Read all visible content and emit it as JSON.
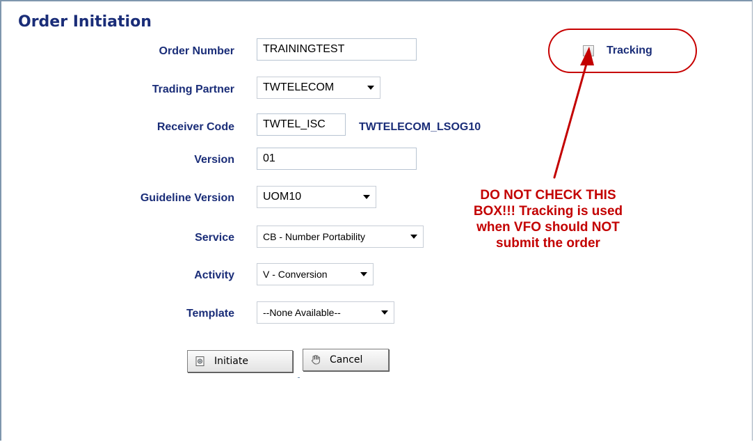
{
  "page": {
    "title": "Order Initiation"
  },
  "fields": {
    "order_number": {
      "label": "Order Number",
      "value": "TRAININGTEST"
    },
    "trading_partner": {
      "label": "Trading Partner",
      "value": "TWTELECOM"
    },
    "receiver_code": {
      "label": "Receiver Code",
      "value": "TWTEL_ISC",
      "name": "TWTELECOM_LSOG10"
    },
    "version": {
      "label": "Version",
      "value": "01"
    },
    "guideline_version": {
      "label": "Guideline Version",
      "value": "UOM10"
    },
    "service": {
      "label": "Service",
      "value": "CB - Number Portability"
    },
    "activity": {
      "label": "Activity",
      "value": "V - Conversion"
    },
    "template": {
      "label": "Template",
      "value": "--None Available--"
    }
  },
  "tracking": {
    "label": "Tracking",
    "checked": false
  },
  "annotation": {
    "text": "DO NOT CHECK THIS\nBOX!!!  Tracking is used\nwhen VFO should NOT\nsubmit the order",
    "color": "#c30000"
  },
  "buttons": {
    "initiate": {
      "label": "Initiate",
      "icon": "initiate-icon"
    },
    "cancel": {
      "label": "Cancel",
      "icon": "hand-icon"
    }
  },
  "colors": {
    "accent": "#1a2d78",
    "highlight": "#c70000"
  }
}
